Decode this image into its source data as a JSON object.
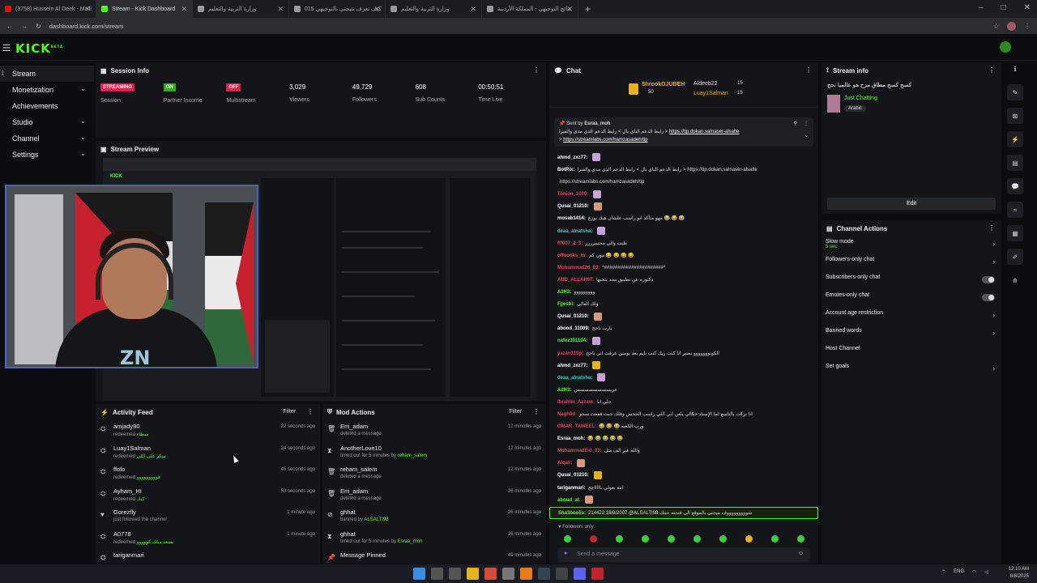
{
  "browser": {
    "tabs": [
      {
        "label": "(3758) Hussein Al Deek - Ma'li",
        "color": "#ff0000"
      },
      {
        "label": "Stream - Kick Dashboard",
        "color": "#53fc18"
      },
      {
        "label": "وزارة التربية والتعليم",
        "color": "#999999"
      },
      {
        "label": "كيف تعرف نتيجتي بالتوجيهي 015",
        "color": "#999999"
      },
      {
        "label": "وزارة التربية والتعليم",
        "color": "#999999"
      },
      {
        "label": "نتائج التوجيهي - المملكة الأردنية",
        "color": "#999999"
      }
    ],
    "new_tab": "+",
    "window_controls": [
      "–",
      "□",
      "✕"
    ],
    "url": "dashboard.kick.com/stream"
  },
  "topnav": {
    "logo": "KICK",
    "logo_sup": "BETA"
  },
  "sidebar": {
    "items": [
      {
        "label": "Stream",
        "icon": "⟟",
        "chev": ""
      },
      {
        "label": "Monetization",
        "icon": "",
        "chev": "⌄"
      },
      {
        "label": "Achievements",
        "icon": "",
        "chev": ""
      },
      {
        "label": "Studio",
        "icon": "",
        "chev": "⌄"
      },
      {
        "label": "Channel",
        "icon": "",
        "chev": "⌄"
      },
      {
        "label": "Settings",
        "icon": "",
        "chev": "⌄"
      }
    ]
  },
  "session": {
    "title": "Session Info",
    "stats": [
      {
        "badge": "STREAMING",
        "badge_color": "#e0204b",
        "label": "Session"
      },
      {
        "badge": "ON",
        "badge_color": "#2faa1a",
        "label": "Partner Income"
      },
      {
        "badge": "OFF",
        "badge_color": "#e0204b",
        "label": "Multistream"
      },
      {
        "value": "3,029",
        "label": "Viewers"
      },
      {
        "value": "49,729",
        "label": "Followers"
      },
      {
        "value": "608",
        "label": "Sub Counts"
      },
      {
        "value": "00:50:51",
        "label": "Time Live"
      }
    ]
  },
  "preview": {
    "title": "Stream Preview"
  },
  "activity": {
    "title": "Activity Feed",
    "filter": "Filter",
    "items": [
      {
        "name": "amjady90",
        "sub": "redeemed",
        "reward": "سطاء",
        "time": "22 seconds ago"
      },
      {
        "name": "Luay1Salman",
        "sub": "redeemed",
        "reward": "سكر على اللي",
        "time": "24 seconds ago"
      },
      {
        "name": "ffofo",
        "sub": "redeemed",
        "reward": "قووووووووو",
        "time": "45 seconds ago"
      },
      {
        "name": "Ayham_HI",
        "sub": "redeemed",
        "reward": "كبك",
        "time": "53 seconds ago"
      },
      {
        "name": "Gorezfly",
        "sub": "just followed the channel",
        "reward": "",
        "time": "1 minute ago"
      },
      {
        "name": "A0778",
        "sub": "redeemed",
        "reward": "يسعد ديلك كووووو",
        "time": "1 minute ago"
      },
      {
        "name": "tariganmari",
        "sub": "",
        "reward": "",
        "time": ""
      }
    ]
  },
  "mod": {
    "title": "Mod Actions",
    "filter": "Filter",
    "items": [
      {
        "name": "Em_adam",
        "sub": "deleted a message",
        "extra": "",
        "time": "12 minutes ago"
      },
      {
        "name": "AnotherLove10",
        "sub": "timed out for 5 minutes by",
        "extra": "reham_salem",
        "time": "12 minutes ago"
      },
      {
        "name": "reham_salem",
        "sub": "deleted a message",
        "extra": "",
        "time": "12 minutes ago"
      },
      {
        "name": "Em_adam",
        "sub": "deleted a message",
        "extra": "",
        "time": "26 minutes ago"
      },
      {
        "name": "ghhat",
        "sub": "banned by",
        "extra": "ALSALTI98",
        "time": "26 minutes ago"
      },
      {
        "name": "ghhat",
        "sub": "timed out for 5 minutes by",
        "extra": "Esraa_moh",
        "time": "26 minutes ago"
      },
      {
        "name": "Message Pinned",
        "sub": "",
        "extra": "",
        "time": "49 minutes ago"
      }
    ]
  },
  "chat": {
    "title": "Chat",
    "gifters": [
      {
        "name": "ShrookOJUBEH",
        "count": "50"
      },
      {
        "name": "Aldeeb22",
        "count": "15"
      },
      {
        "name": "Luay1Salman",
        "count": "15"
      }
    ],
    "pinned": {
      "sent_by": "Sent by",
      "author": "Esraa_moh",
      "line1": "رابط الدعم الباي بال > رابط الدعم الذي مدى والفيزا >",
      "link1": "https://tip.dokan.sa/naser-alsalte",
      "line2": ">",
      "link2": "https://streamlabs.com/hamzasadeh/tip"
    },
    "messages": [
      {
        "user": "ahmd_zxz77:",
        "color": "#ffffff",
        "text": ""
      },
      {
        "user": "BotRix:",
        "color": "#ffffff",
        "text": "رابط الدعم الباي بال > رابط الدعم الذي مدى والفيزا > https://tip.dokan.sa/naser-alsalte"
      },
      {
        "user": "",
        "color": "#ffffff",
        "text": "https://streamlabs.com/hamzasadeh/tip"
      },
      {
        "user": "Tonion_1000:",
        "color": "#e84057",
        "text": ""
      },
      {
        "user": "Qusai_01210:",
        "color": "#ffffff",
        "text": ""
      },
      {
        "user": "mosab1414:",
        "color": "#ffffff",
        "text": "مهو متأكد انو راسب علشان هيك بوزع 😂 😂 😂"
      },
      {
        "user": "deaa_alnatsha:",
        "color": "#3ac9c9",
        "text": ""
      },
      {
        "user": "fff007_2_3:",
        "color": "#e84057",
        "text": "طيب والي محتبيرررر"
      },
      {
        "user": "offoooks_m:",
        "color": "#e84057",
        "text": "مون كم 😂 😂 😂 😂"
      },
      {
        "user": "Mohammad2d_03:",
        "color": "#e84057",
        "text": "*######################*"
      },
      {
        "user": "ABD_ALLAH9T:",
        "color": "#e84057",
        "text": "دكتوره عن تطبيق سند بتجيها"
      },
      {
        "user": "A2H3:",
        "color": "#53fc18",
        "text": "ووووووووو"
      },
      {
        "user": "Fjjesbi:",
        "color": "#53fc18",
        "text": "ولك الغالي"
      },
      {
        "user": "Qusai_01210:",
        "color": "#ffffff",
        "text": ""
      },
      {
        "user": "abood_11009:",
        "color": "#ffffff",
        "text": "يارب ناجح"
      },
      {
        "user": "nafez101104:",
        "color": "#53fc18",
        "text": ""
      },
      {
        "user": "yazan11tip:",
        "color": "#e84057",
        "text": "الكونووووووو نصير انا كنت زيك كنت نايم بعد يومين عرفت اني ناجح"
      },
      {
        "user": "ahmd_zxz77:",
        "color": "#ffffff",
        "text": ""
      },
      {
        "user": "deaa_alnatsha:",
        "color": "#3ac9c9",
        "text": ""
      },
      {
        "user": "A2H3:",
        "color": "#53fc18",
        "text": "عريسسسسسسسس"
      },
      {
        "user": "Ibrahim_Azzam:",
        "color": "#e84057",
        "text": "حلي انا"
      },
      {
        "user": "Nagh0d:",
        "color": "#e84057",
        "text": "انا تركت بالتاسع لما الإسناد حكالي يلعن ابي اللي راسب الجحش وفلك جبت قفعت سحو"
      },
      {
        "user": "OMAR_TAWEEL:",
        "color": "#e84057",
        "text": "😂 😂 😂 ورب الكعبه"
      },
      {
        "user": "Esraa_moh:",
        "color": "#ffffff",
        "text": "😂 😂 😂 😂 😂"
      },
      {
        "user": "MohammadEid_03:",
        "color": "#e84057",
        "text": "والله غير الف مثل"
      },
      {
        "user": "Alqali:",
        "color": "#e84057",
        "text": ""
      },
      {
        "user": "Qusai_01210:",
        "color": "#ffffff",
        "text": ""
      },
      {
        "user": "tariganmari:",
        "color": "#ffffff",
        "text": "انته بعولي ناااااجح"
      },
      {
        "user": "aboud_al:",
        "color": "#53fc18",
        "text": ""
      },
      {
        "user": "Sha3boolis:",
        "color": "#53fc18",
        "text": "214422 18/8/2007 @ALSALTI98 شوووووووووف نتيجتي بالموقع الي فتحته حتتك"
      }
    ],
    "followers_only": "Followers only",
    "placeholder": "Send a message"
  },
  "stream_info": {
    "title": "Stream info",
    "stream_title": "كسح كسح مطاق مزح هو عالميا نجح",
    "category": "Just Chatting",
    "tag": "Arabic",
    "edit": "Edit"
  },
  "channel_actions": {
    "title": "Channel Actions",
    "items": [
      {
        "label": "Slow mode",
        "sub": "5 sec",
        "control": "arrow"
      },
      {
        "label": "Followers-only chat",
        "sub": "",
        "control": "arrow"
      },
      {
        "label": "Subscribers-only chat",
        "sub": "",
        "control": "toggle"
      },
      {
        "label": "Emotes-only chat",
        "sub": "",
        "control": "toggle"
      },
      {
        "label": "Account age restriction",
        "sub": "",
        "control": "arrow"
      },
      {
        "label": "Banned words",
        "sub": "",
        "control": "arrow"
      },
      {
        "label": "Host Channel",
        "sub": "",
        "control": ""
      },
      {
        "label": "Set goals",
        "sub": "",
        "control": "arrow"
      }
    ]
  },
  "rail": [
    "ℹ",
    "✎",
    "⊠",
    "⚡",
    "▤",
    "💬",
    "≈",
    "▦",
    "✐",
    "⋔"
  ],
  "taskbar": {
    "lang": "ENG",
    "time": "12:10 AM",
    "date": "8/8/2025"
  }
}
